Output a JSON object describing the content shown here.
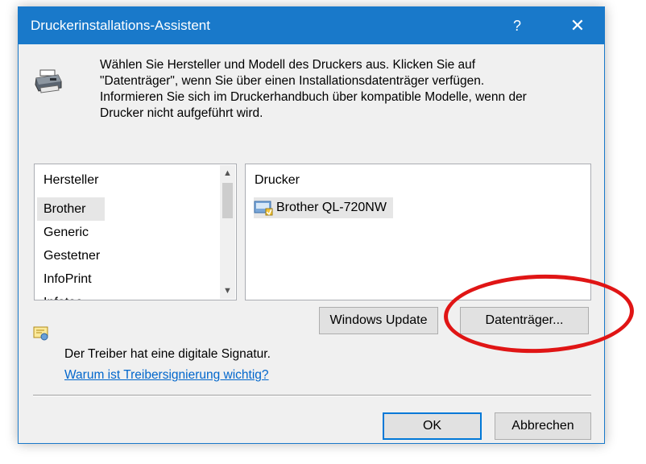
{
  "dialog": {
    "title": "Druckerinstallations-Assistent",
    "help_glyph": "?",
    "close_glyph": "✕",
    "intro_text": "Wählen Sie Hersteller und Modell des Druckers aus. Klicken Sie auf\n\"Datenträger\", wenn Sie über einen Installationsdatenträger verfügen.\nInformieren Sie sich im Druckerhandbuch über kompatible Modelle, wenn der\nDrucker nicht aufgeführt wird.",
    "icons": {
      "header": "printer-icon",
      "signature": "certificate-icon",
      "driver": "printer-driver-icon"
    }
  },
  "manufacturer_list": {
    "header": "Hersteller",
    "items": [
      "Brother",
      "Generic",
      "Gestetner",
      "InfoPrint",
      "Infotec"
    ],
    "selected": "Brother"
  },
  "printer_list": {
    "header": "Drucker",
    "items": [
      "Brother QL-720NW"
    ]
  },
  "buttons": {
    "windows_update": "Windows Update",
    "have_disk": "Datenträger...",
    "ok": "OK",
    "cancel": "Abbrechen"
  },
  "signature": {
    "text": "Der Treiber hat eine digitale Signatur.",
    "link": "Warum ist Treibersignierung wichtig?"
  },
  "colors": {
    "title_bar": "#1979ca",
    "annotation": "#e01515",
    "link": "#0066cc",
    "selection": "#e6e6e6"
  }
}
